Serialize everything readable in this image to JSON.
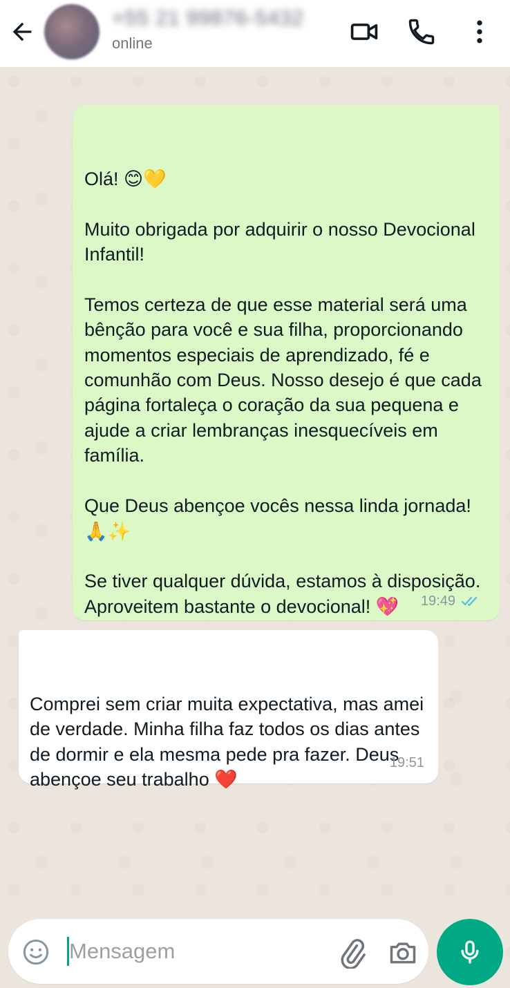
{
  "header": {
    "contact_name": "+55 21 99876-5432",
    "status": "online",
    "icons": [
      "back-arrow-icon",
      "avatar",
      "video-call-icon",
      "phone-call-icon",
      "more-options-icon"
    ]
  },
  "messages": [
    {
      "direction": "outgoing",
      "text": "Olá! 😊💛\n\nMuito obrigada por adquirir o nosso Devocional Infantil!\n\nTemos certeza de que esse material será uma bênção para você e sua filha, proporcionando momentos especiais de aprendizado, fé e comunhão com Deus. Nosso desejo é que cada página fortaleça o coração da sua pequena e ajude a criar lembranças inesquecíveis em família.\n\nQue Deus abençoe vocês nessa linda jornada! 🙏✨\n\nSe tiver qualquer dúvida, estamos à disposição. Aproveitem bastante o devocional! 💖",
      "time": "19:49",
      "status": "read"
    },
    {
      "direction": "incoming",
      "text": "Comprei sem criar muita expectativa, mas amei de verdade. Minha filha faz todos os dias antes de dormir e ela mesma pede pra fazer. Deus abençoe seu trabalho ❤️",
      "time": "19:51"
    }
  ],
  "composer": {
    "placeholder": "Mensagem",
    "value": ""
  },
  "colors": {
    "outgoing_bubble": "#dcf8c6",
    "incoming_bubble": "#ffffff",
    "accent": "#00a884",
    "read_ticks": "#53bdeb"
  }
}
